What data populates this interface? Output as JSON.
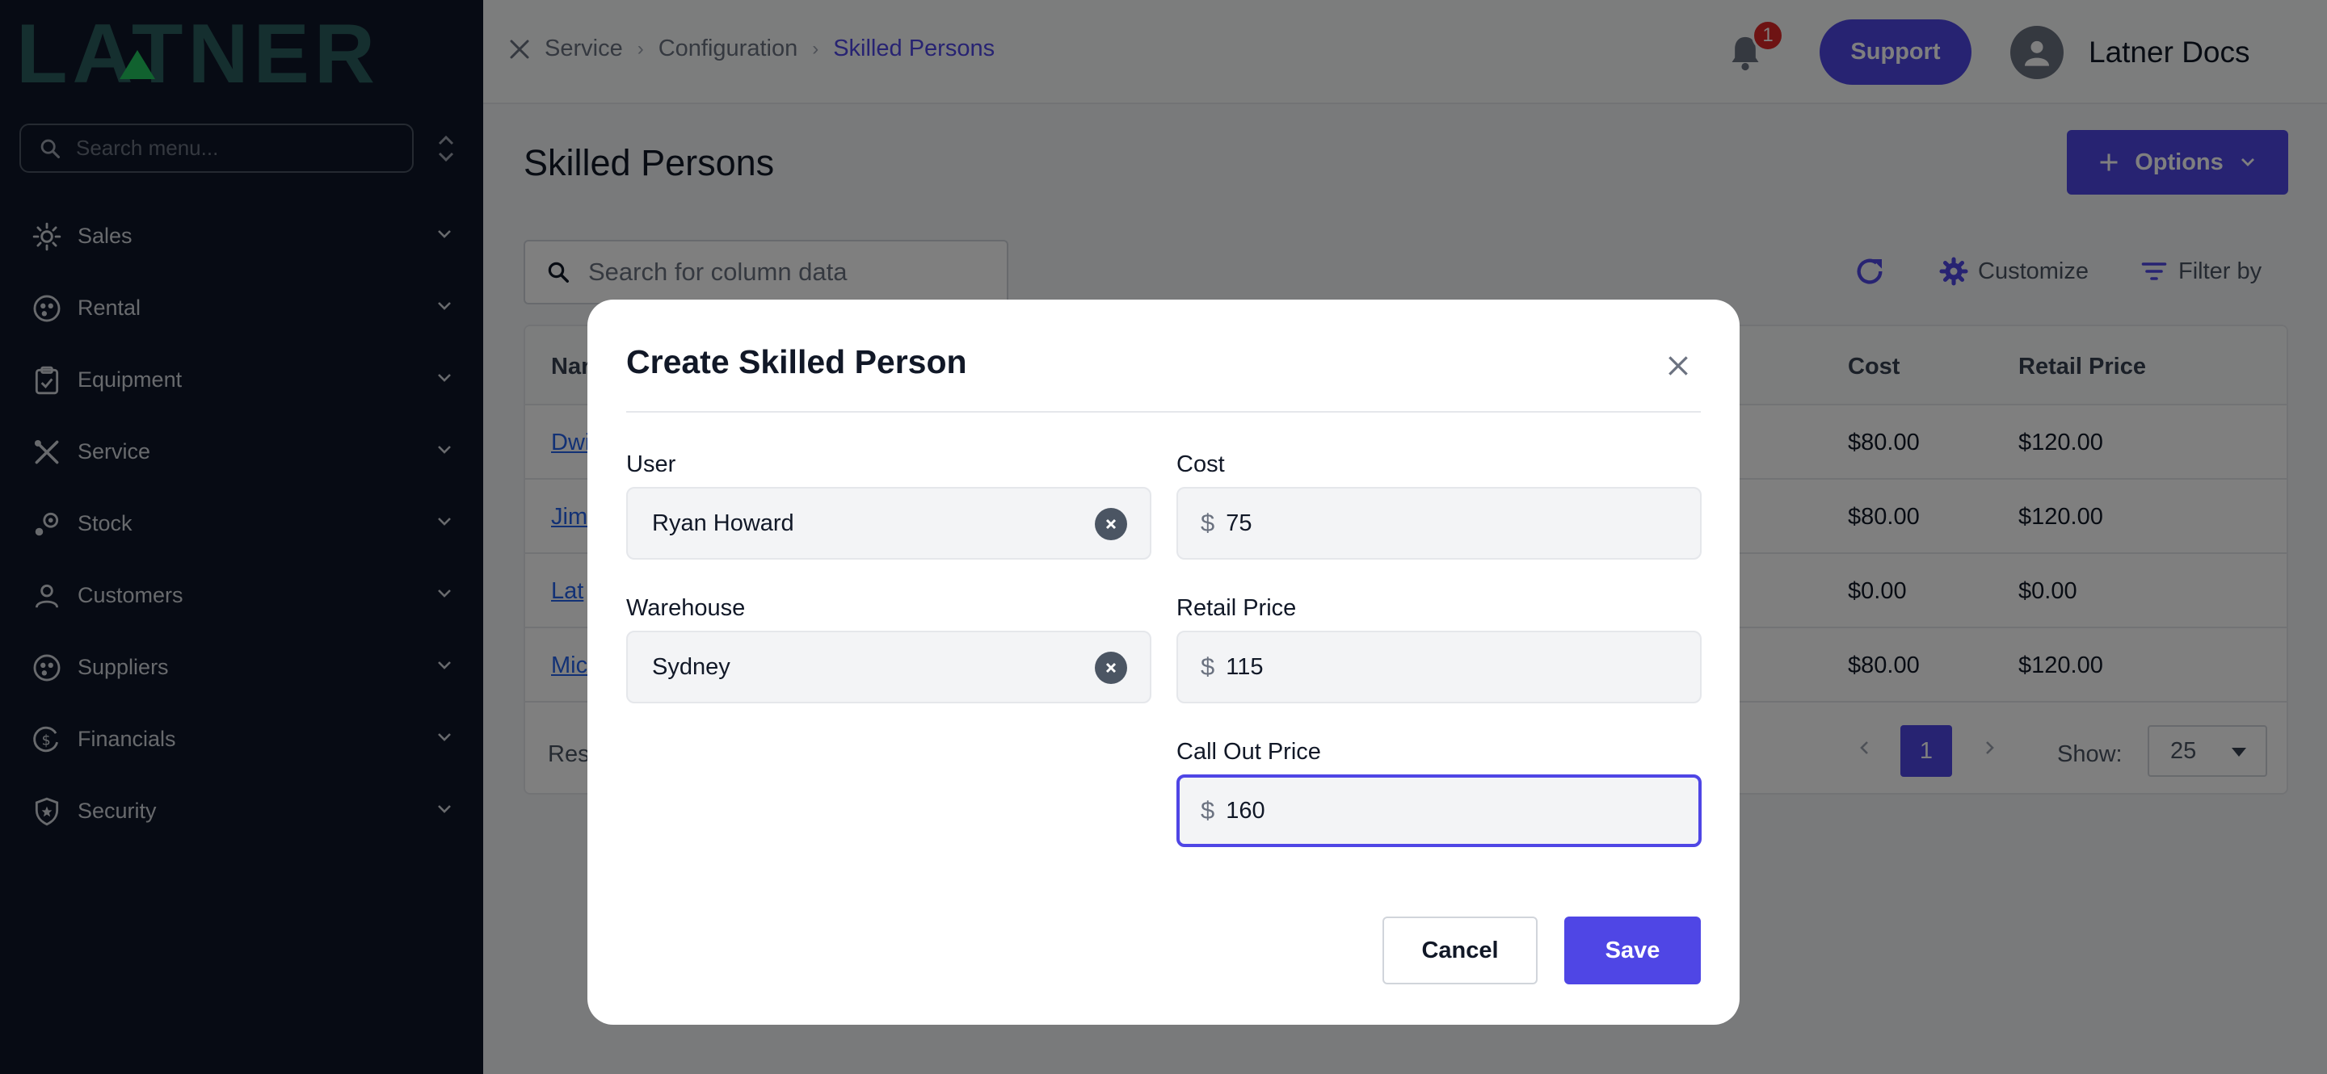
{
  "app": {
    "logo_text": "LATNER",
    "account_name": "Latner Docs"
  },
  "sidebar": {
    "search_placeholder": "Search menu...",
    "items": [
      {
        "label": "Sales",
        "icon": "sales-icon"
      },
      {
        "label": "Rental",
        "icon": "rental-icon"
      },
      {
        "label": "Equipment",
        "icon": "clipboard-icon"
      },
      {
        "label": "Service",
        "icon": "tools-icon"
      },
      {
        "label": "Stock",
        "icon": "stock-icon"
      },
      {
        "label": "Customers",
        "icon": "user-icon"
      },
      {
        "label": "Suppliers",
        "icon": "suppliers-icon"
      },
      {
        "label": "Financials",
        "icon": "dollar-cycle-icon"
      },
      {
        "label": "Security",
        "icon": "shield-icon"
      }
    ]
  },
  "header": {
    "breadcrumb": [
      "Service",
      "Configuration",
      "Skilled Persons"
    ],
    "notification_count": "1",
    "support_label": "Support"
  },
  "main": {
    "title": "Skilled Persons",
    "options_label": "Options",
    "search_placeholder": "Search for column data",
    "customize_label": "Customize",
    "filter_label": "Filter by",
    "table": {
      "columns": [
        "Nar",
        "Cost",
        "Retail Price"
      ],
      "rows": [
        {
          "name": "Dwi",
          "cost": "$80.00",
          "retail": "$120.00"
        },
        {
          "name": "Jim",
          "cost": "$80.00",
          "retail": "$120.00"
        },
        {
          "name": "Lat",
          "cost": "$0.00",
          "retail": "$0.00"
        },
        {
          "name": "Mic",
          "cost": "$80.00",
          "retail": "$120.00"
        }
      ],
      "results_label": "Resu",
      "current_page": "1",
      "show_label": "Show:",
      "page_size": "25"
    }
  },
  "modal": {
    "title": "Create Skilled Person",
    "user_label": "User",
    "user_value": "Ryan Howard",
    "warehouse_label": "Warehouse",
    "warehouse_value": "Sydney",
    "cost_label": "Cost",
    "cost_value": "75",
    "retail_label": "Retail Price",
    "retail_value": "115",
    "callout_label": "Call Out Price",
    "callout_value": "160",
    "currency_symbol": "$",
    "cancel_label": "Cancel",
    "save_label": "Save"
  },
  "colors": {
    "accent": "#4f46e5",
    "sidebar_bg": "#0f1729",
    "badge": "#dc2626",
    "logo": "#2d5f5f"
  }
}
